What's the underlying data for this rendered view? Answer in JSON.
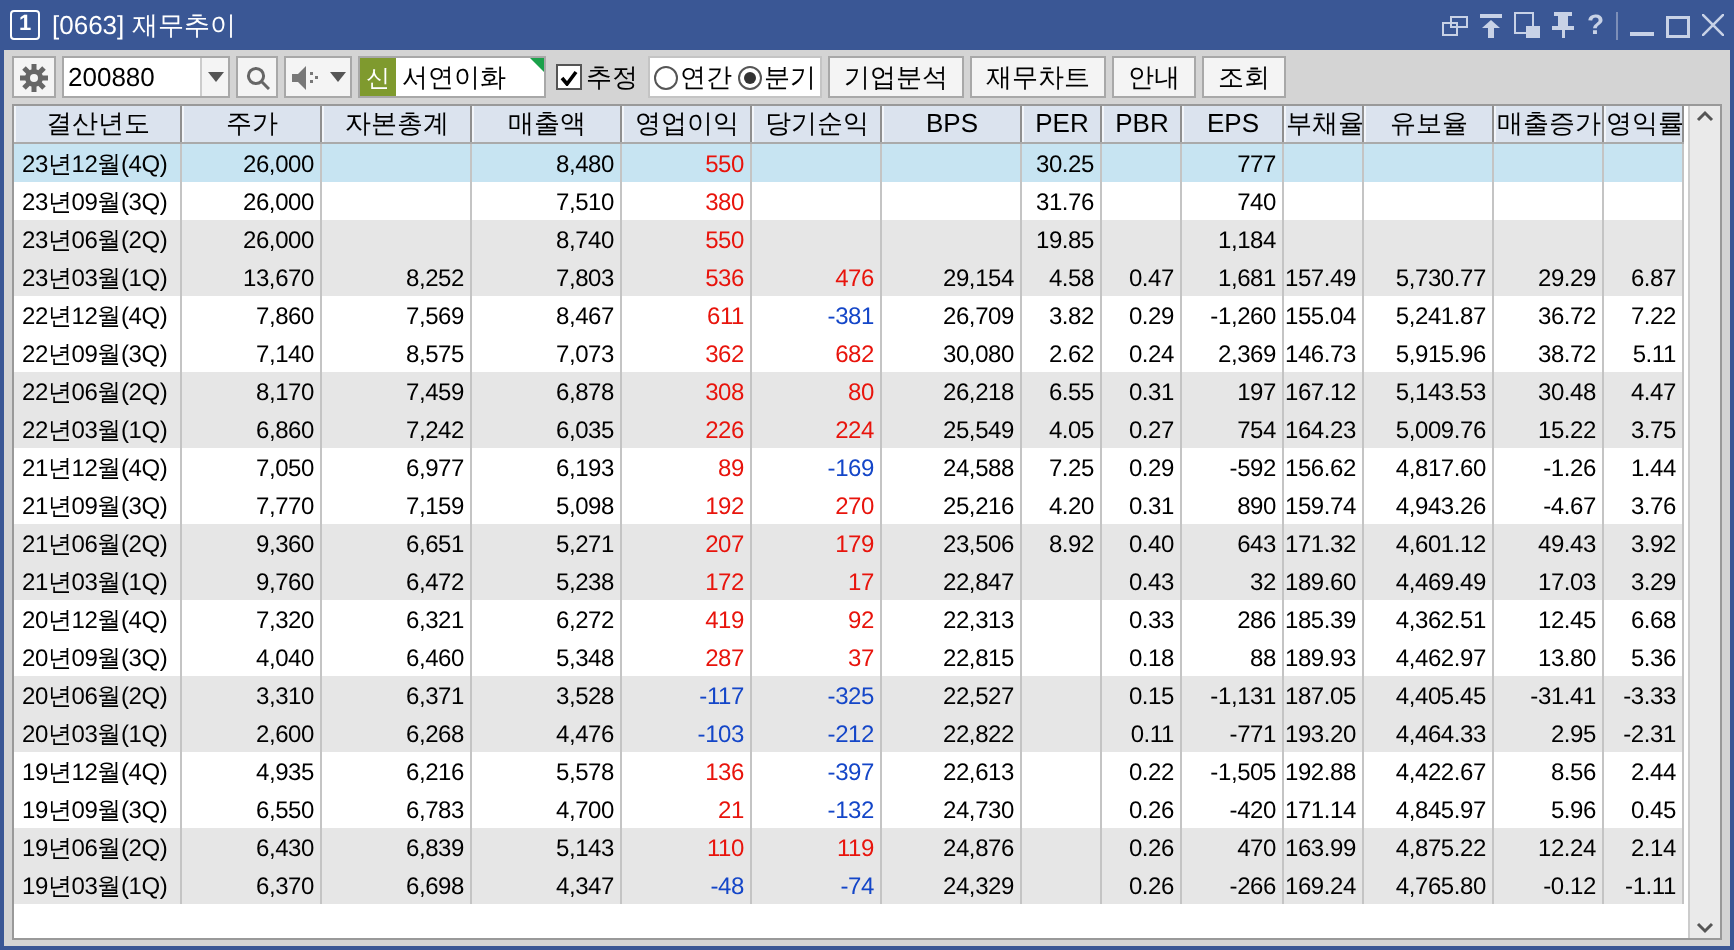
{
  "window": {
    "number": "1",
    "title": "[0663] 재무추이",
    "help": "?"
  },
  "toolbar": {
    "code": "200880",
    "market_badge": "신",
    "company": "서연이화",
    "estimate": {
      "label": "추정",
      "checked": true
    },
    "period": [
      {
        "label": "연간",
        "selected": false
      },
      {
        "label": "분기",
        "selected": true
      }
    ],
    "buttons": [
      "기업분석",
      "재무차트",
      "안내",
      "조회"
    ]
  },
  "table": {
    "columns": [
      "결산년도",
      "주가",
      "자본총계",
      "매출액",
      "영업이익",
      "당기순익",
      "BPS",
      "PER",
      "PBR",
      "EPS",
      "부채율",
      "유보율",
      "매출증가",
      "영익률"
    ],
    "rows": [
      {
        "selected": true,
        "cells": [
          "23년12월(4Q)",
          "26,000",
          null,
          "8,480",
          {
            "text": "550",
            "color": "#e8140c"
          },
          null,
          null,
          "30.25",
          null,
          "777",
          null,
          null,
          null,
          null
        ]
      },
      {
        "selected": false,
        "cells": [
          "23년09월(3Q)",
          "26,000",
          null,
          "7,510",
          {
            "text": "380",
            "color": "#e8140c"
          },
          null,
          null,
          "31.76",
          null,
          "740",
          null,
          null,
          null,
          null
        ]
      },
      {
        "selected": false,
        "cells": [
          "23년06월(2Q)",
          "26,000",
          null,
          "8,740",
          {
            "text": "550",
            "color": "#e8140c"
          },
          null,
          null,
          "19.85",
          null,
          "1,184",
          null,
          null,
          null,
          null
        ]
      },
      {
        "selected": false,
        "cells": [
          "23년03월(1Q)",
          "13,670",
          "8,252",
          "7,803",
          {
            "text": "536",
            "color": "#e8140c"
          },
          {
            "text": "476",
            "color": "#e8140c"
          },
          "29,154",
          "4.58",
          "0.47",
          "1,681",
          "157.49",
          "5,730.77",
          "29.29",
          "6.87"
        ]
      },
      {
        "selected": false,
        "cells": [
          "22년12월(4Q)",
          "7,860",
          "7,569",
          "8,467",
          {
            "text": "611",
            "color": "#e8140c"
          },
          {
            "text": "-381",
            "color": "#1446c8"
          },
          "26,709",
          "3.82",
          "0.29",
          "-1,260",
          "155.04",
          "5,241.87",
          "36.72",
          "7.22"
        ]
      },
      {
        "selected": false,
        "cells": [
          "22년09월(3Q)",
          "7,140",
          "8,575",
          "7,073",
          {
            "text": "362",
            "color": "#e8140c"
          },
          {
            "text": "682",
            "color": "#e8140c"
          },
          "30,080",
          "2.62",
          "0.24",
          "2,369",
          "146.73",
          "5,915.96",
          "38.72",
          "5.11"
        ]
      },
      {
        "selected": false,
        "cells": [
          "22년06월(2Q)",
          "8,170",
          "7,459",
          "6,878",
          {
            "text": "308",
            "color": "#e8140c"
          },
          {
            "text": "80",
            "color": "#e8140c"
          },
          "26,218",
          "6.55",
          "0.31",
          "197",
          "167.12",
          "5,143.53",
          "30.48",
          "4.47"
        ]
      },
      {
        "selected": false,
        "cells": [
          "22년03월(1Q)",
          "6,860",
          "7,242",
          "6,035",
          {
            "text": "226",
            "color": "#e8140c"
          },
          {
            "text": "224",
            "color": "#e8140c"
          },
          "25,549",
          "4.05",
          "0.27",
          "754",
          "164.23",
          "5,009.76",
          "15.22",
          "3.75"
        ]
      },
      {
        "selected": false,
        "cells": [
          "21년12월(4Q)",
          "7,050",
          "6,977",
          "6,193",
          {
            "text": "89",
            "color": "#e8140c"
          },
          {
            "text": "-169",
            "color": "#1446c8"
          },
          "24,588",
          "7.25",
          "0.29",
          "-592",
          "156.62",
          "4,817.60",
          "-1.26",
          "1.44"
        ]
      },
      {
        "selected": false,
        "cells": [
          "21년09월(3Q)",
          "7,770",
          "7,159",
          "5,098",
          {
            "text": "192",
            "color": "#e8140c"
          },
          {
            "text": "270",
            "color": "#e8140c"
          },
          "25,216",
          "4.20",
          "0.31",
          "890",
          "159.74",
          "4,943.26",
          "-4.67",
          "3.76"
        ]
      },
      {
        "selected": false,
        "cells": [
          "21년06월(2Q)",
          "9,360",
          "6,651",
          "5,271",
          {
            "text": "207",
            "color": "#e8140c"
          },
          {
            "text": "179",
            "color": "#e8140c"
          },
          "23,506",
          "8.92",
          "0.40",
          "643",
          "171.32",
          "4,601.12",
          "49.43",
          "3.92"
        ]
      },
      {
        "selected": false,
        "cells": [
          "21년03월(1Q)",
          "9,760",
          "6,472",
          "5,238",
          {
            "text": "172",
            "color": "#e8140c"
          },
          {
            "text": "17",
            "color": "#e8140c"
          },
          "22,847",
          null,
          "0.43",
          "32",
          "189.60",
          "4,469.49",
          "17.03",
          "3.29"
        ]
      },
      {
        "selected": false,
        "cells": [
          "20년12월(4Q)",
          "7,320",
          "6,321",
          "6,272",
          {
            "text": "419",
            "color": "#e8140c"
          },
          {
            "text": "92",
            "color": "#e8140c"
          },
          "22,313",
          null,
          "0.33",
          "286",
          "185.39",
          "4,362.51",
          "12.45",
          "6.68"
        ]
      },
      {
        "selected": false,
        "cells": [
          "20년09월(3Q)",
          "4,040",
          "6,460",
          "5,348",
          {
            "text": "287",
            "color": "#e8140c"
          },
          {
            "text": "37",
            "color": "#e8140c"
          },
          "22,815",
          null,
          "0.18",
          "88",
          "189.93",
          "4,462.97",
          "13.80",
          "5.36"
        ]
      },
      {
        "selected": false,
        "cells": [
          "20년06월(2Q)",
          "3,310",
          "6,371",
          "3,528",
          {
            "text": "-117",
            "color": "#1446c8"
          },
          {
            "text": "-325",
            "color": "#1446c8"
          },
          "22,527",
          null,
          "0.15",
          "-1,131",
          "187.05",
          "4,405.45",
          "-31.41",
          "-3.33"
        ]
      },
      {
        "selected": false,
        "cells": [
          "20년03월(1Q)",
          "2,600",
          "6,268",
          "4,476",
          {
            "text": "-103",
            "color": "#1446c8"
          },
          {
            "text": "-212",
            "color": "#1446c8"
          },
          "22,822",
          null,
          "0.11",
          "-771",
          "193.20",
          "4,464.33",
          "2.95",
          "-2.31"
        ]
      },
      {
        "selected": false,
        "cells": [
          "19년12월(4Q)",
          "4,935",
          "6,216",
          "5,578",
          {
            "text": "136",
            "color": "#e8140c"
          },
          {
            "text": "-397",
            "color": "#1446c8"
          },
          "22,613",
          null,
          "0.22",
          "-1,505",
          "192.88",
          "4,422.67",
          "8.56",
          "2.44"
        ]
      },
      {
        "selected": false,
        "cells": [
          "19년09월(3Q)",
          "6,550",
          "6,783",
          "4,700",
          {
            "text": "21",
            "color": "#e8140c"
          },
          {
            "text": "-132",
            "color": "#1446c8"
          },
          "24,730",
          null,
          "0.26",
          "-420",
          "171.14",
          "4,845.97",
          "5.96",
          "0.45"
        ]
      },
      {
        "selected": false,
        "cells": [
          "19년06월(2Q)",
          "6,430",
          "6,839",
          "5,143",
          {
            "text": "110",
            "color": "#e8140c"
          },
          {
            "text": "119",
            "color": "#e8140c"
          },
          "24,876",
          null,
          "0.26",
          "470",
          "163.99",
          "4,875.22",
          "12.24",
          "2.14"
        ]
      },
      {
        "selected": false,
        "cells": [
          "19년03월(1Q)",
          "6,370",
          "6,698",
          "4,347",
          {
            "text": "-48",
            "color": "#1446c8"
          },
          {
            "text": "-74",
            "color": "#1446c8"
          },
          "24,329",
          null,
          "0.26",
          "-266",
          "169.24",
          "4,765.80",
          "-0.12",
          "-1.11"
        ]
      }
    ]
  }
}
